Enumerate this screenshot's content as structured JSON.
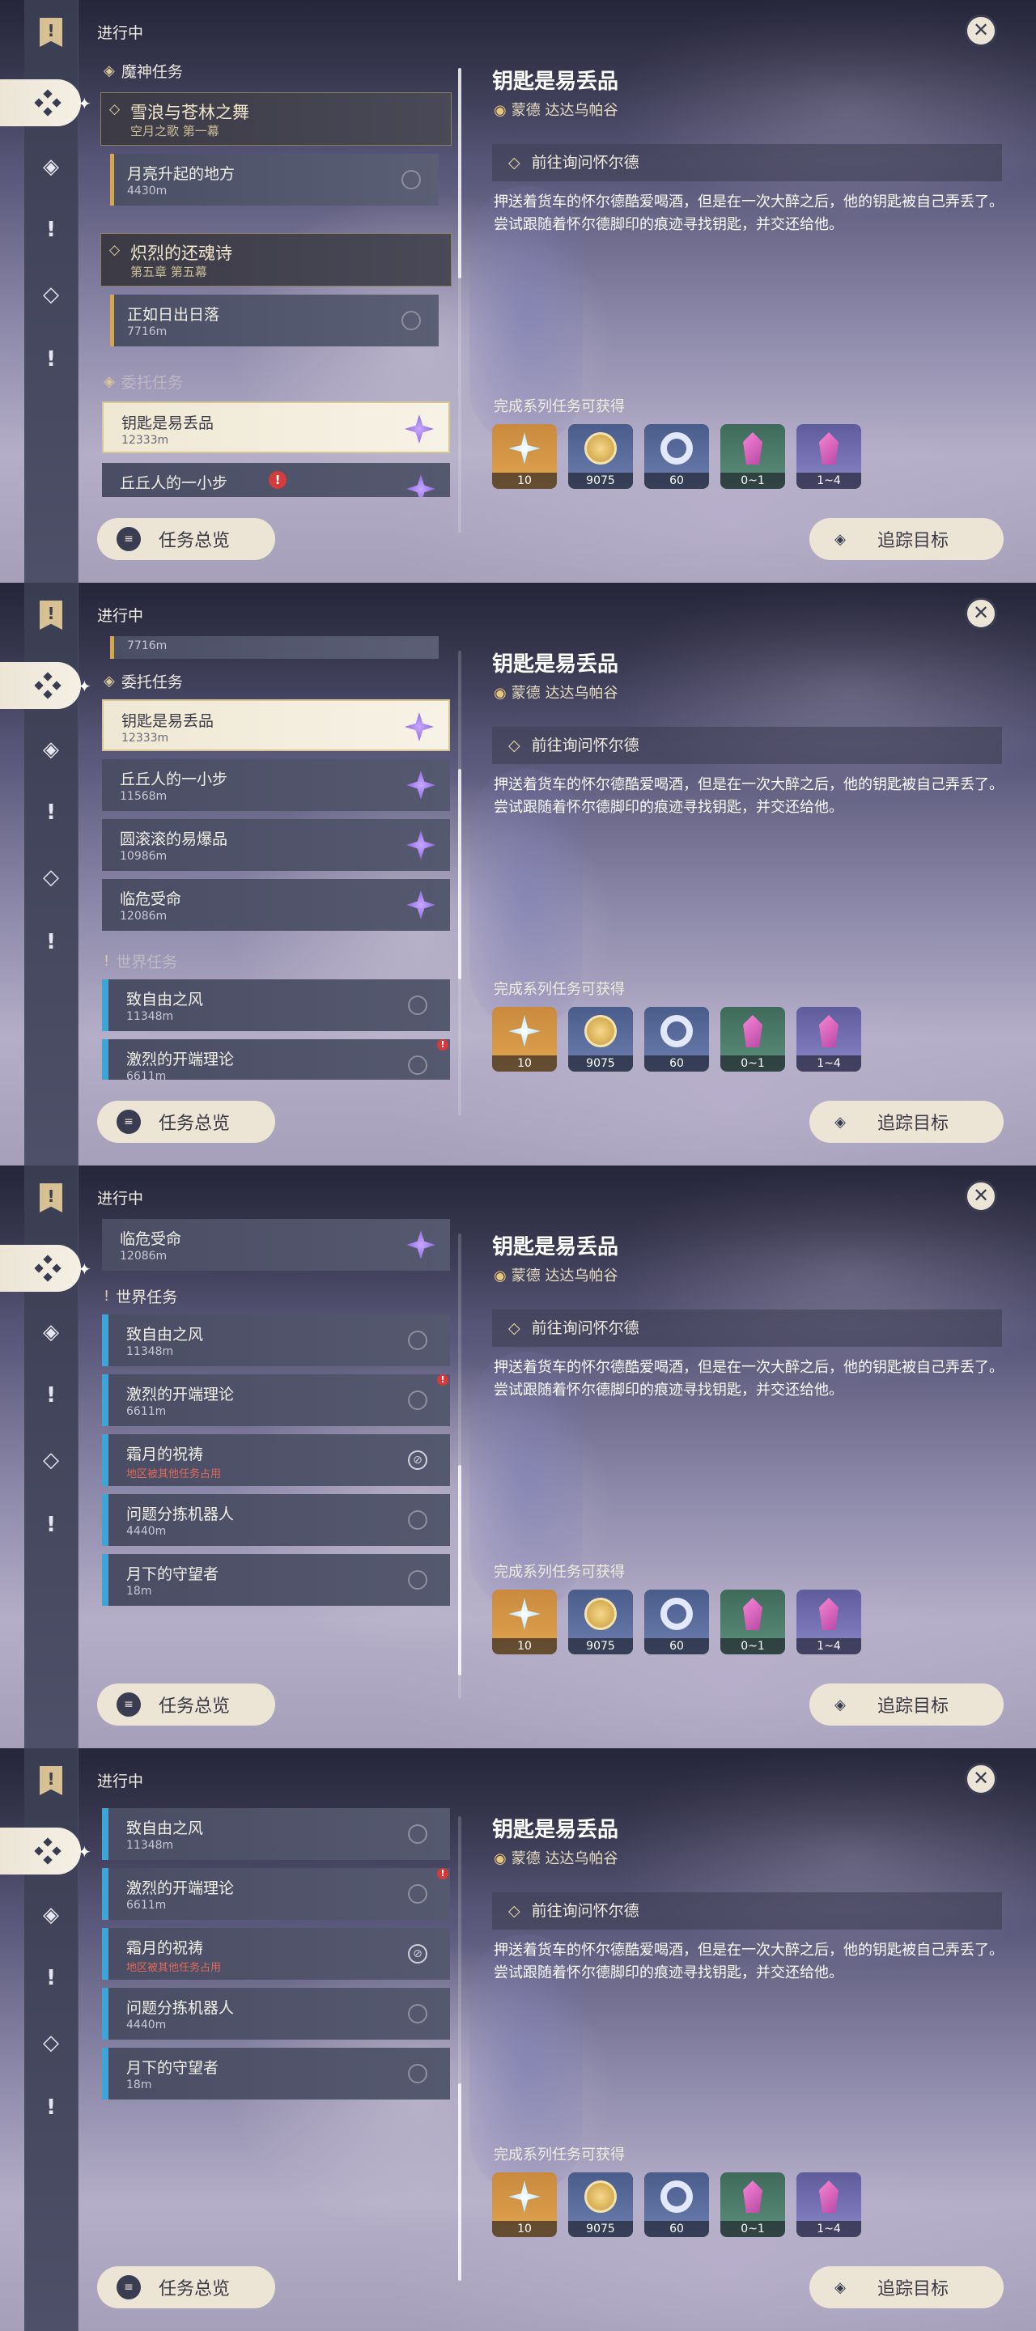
{
  "app": {
    "status_label": "进行中",
    "close_icon": "close-icon",
    "overview_button": "任务总览",
    "track_button": "追踪目标"
  },
  "detail": {
    "title": "钥匙是易丢品",
    "location": "蒙德 达达乌帕谷",
    "objective": "前往询问怀尔德",
    "description": "押送着货车的怀尔德酷爱喝酒，但是在一次大醉之后，他的钥匙被自己弄丢了。尝试跟随着怀尔德脚印的痕迹寻找钥匙，并交还给他。",
    "reward_title": "完成系列任务可获得",
    "rewards": [
      {
        "icon": "primogem-icon",
        "amount": "10"
      },
      {
        "icon": "mora-icon",
        "amount": "9075"
      },
      {
        "icon": "fetters-icon",
        "amount": "60"
      },
      {
        "icon": "crystal-icon",
        "amount": "0~1"
      },
      {
        "icon": "crystal-cluster-icon",
        "amount": "1~4"
      }
    ]
  },
  "sections": {
    "archon": "魔神任务",
    "commission": "委托任务",
    "world": "世界任务"
  },
  "archon_quests": [
    {
      "title": "雪浪与苍林之舞",
      "subtitle": "空月之歌 第一幕",
      "step": "月亮升起的地方",
      "distance": "4430m"
    },
    {
      "title": "炽烈的还魂诗",
      "subtitle": "第五章 第五幕",
      "step": "正如日出日落",
      "distance": "7716m"
    }
  ],
  "commission_quests": [
    {
      "title": "钥匙是易丢品",
      "distance": "12333m"
    },
    {
      "title": "丘丘人的一小步",
      "distance": "11568m"
    },
    {
      "title": "圆滚滚的易爆品",
      "distance": "10986m"
    },
    {
      "title": "临危受命",
      "distance": "12086m"
    }
  ],
  "world_quests": [
    {
      "title": "致自由之风",
      "distance": "11348m"
    },
    {
      "title": "激烈的开端理论",
      "distance": "6611m"
    },
    {
      "title": "霜月的祝祷",
      "note": "地区被其他任务占用"
    },
    {
      "title": "问题分拣机器人",
      "distance": "4440m"
    },
    {
      "title": "月下的守望者",
      "distance": "18m"
    }
  ],
  "misc": {
    "partial_distance": "7716m"
  }
}
